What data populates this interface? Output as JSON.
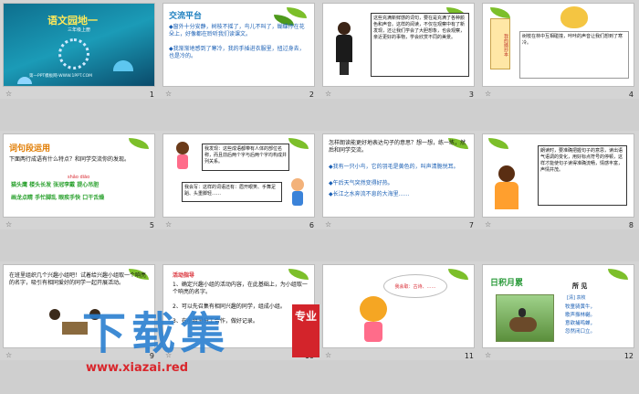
{
  "slides": [
    {
      "num": "1",
      "title": "语文园地一",
      "subtitle": "三年级上册",
      "credit": "第一PPT模板网-WWW.1PPT.COM"
    },
    {
      "num": "2",
      "title": "交流平台",
      "lines": [
        "◆窗外十分安静，树枝不摇了，鸟儿不叫了，蝴蝶停在花朵上，好像都在聆听我们读课文。",
        "◆我渐渐地感到了寒冷，我的手插进衣服里，扭过身去，也是冷的。"
      ]
    },
    {
      "num": "3",
      "text": "这些充满新鲜感的词句，要在是充满了各种颜色和声音。这样的阅读，不仅在观察中有了新发现，还让我们学会了大胆想象，也会观察，亲近更好的事物，学会欣赏不同的美景。"
    },
    {
      "num": "4",
      "card": "我的摘抄本",
      "text": "树枝在林中互相碰撞，咔咔的声音让我们想到了寒冷。"
    },
    {
      "num": "5",
      "title": "词句段运用",
      "q": "下面两行成语有什么特点？和同学交流你的发现。",
      "pinyin": "shǎo   diāo",
      "row1": "猫头鹰  楼头长发  张冠李戴  提心吊胆",
      "row2": "画龙点睛  手忙脚乱  眼疾手快  口干舌燥"
    },
    {
      "num": "6",
      "bubble1": "我发现：这些成语都带有人体的部位名称，而且前后两个字与后两个字均构成并列关系。",
      "bubble2": "我会写：这样的词语还有：眉开眼笑、手舞足蹈、头重脚轻……"
    },
    {
      "num": "7",
      "q": "怎样朗读能更好地表达句子的意思？想一想，练一练，然后和同学交流。",
      "lines": [
        "◆我有一只小鸟，它的羽毛是黄色的，叫声清脆悦耳。",
        "◆午后天气突然变得好热。",
        "◆长江之水奔流不息的大海里……"
      ]
    },
    {
      "num": "8",
      "text": "朗读时，要准确把握句子的意思，读出语气语调的变化，用好标点符号的停顿，这样才能使句子读得准确流畅，情感丰富，声情并茂。"
    },
    {
      "num": "9",
      "q": "在班里组织几个兴趣小组吧！试着给兴趣小组取一个响亮的名字，吸引有相同爱好的同学一起开展活动。"
    },
    {
      "num": "10",
      "head": "活动指导",
      "lines": [
        "1、确定兴趣小组的活动内容，在此基础上，为小组取一个响亮的名字。",
        "2、可以先召集有相同兴趣的同学，组成小组。",
        "3、在小组里分工合作，做好记录。"
      ]
    },
    {
      "num": "11",
      "text": "我会取：古诗、……"
    },
    {
      "num": "12",
      "title": "日积月累",
      "poem_title": "所 见",
      "author": "[清] 袁枚",
      "poem": [
        "牧童骑黄牛，",
        "歌声振林樾。",
        "意欲捕鸣蝉，",
        "忽然闭口立。"
      ]
    }
  ],
  "watermark": {
    "big": "下载集",
    "seal": "专业",
    "url": "www.xiazai.red"
  },
  "colors": {
    "accent_blue": "#1d7fbf",
    "accent_red": "#d8262e",
    "leaf": "#7cbf2a"
  }
}
